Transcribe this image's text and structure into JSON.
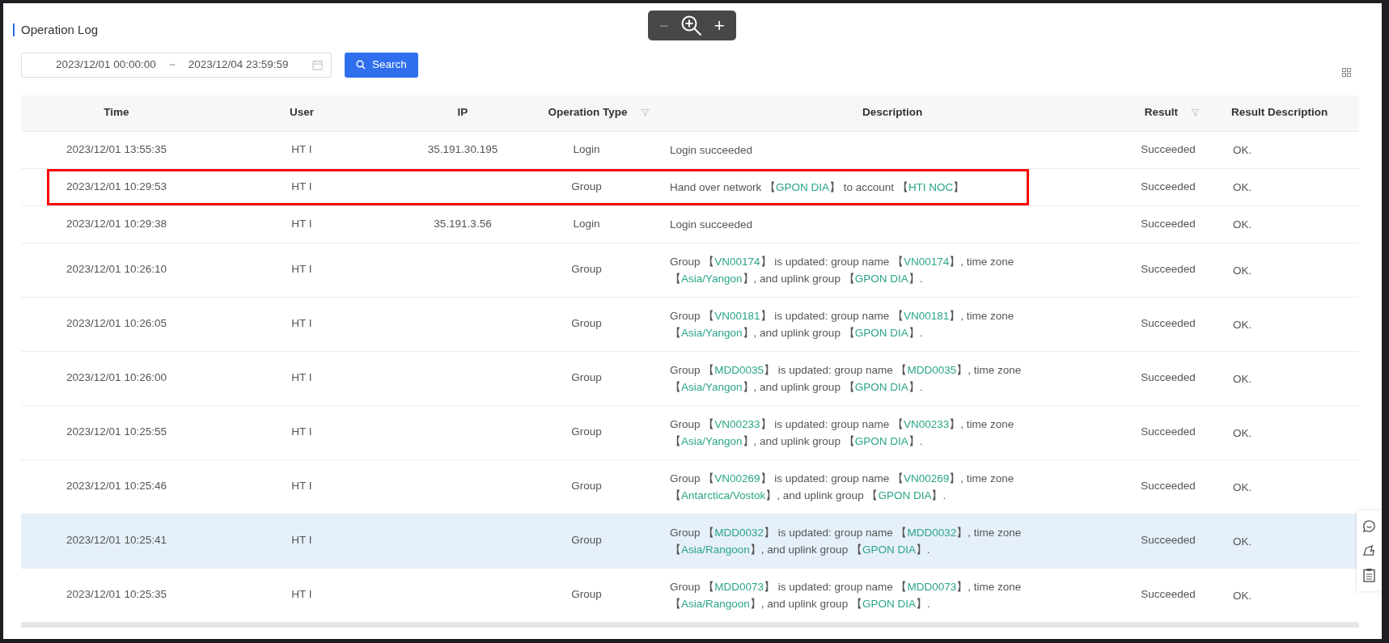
{
  "page_title": "Operation Log",
  "zoom_toolbar": {
    "minus": "−",
    "minus_disabled": true,
    "plus": "+"
  },
  "date_range": {
    "start": "2023/12/01 00:00:00",
    "separator": "~",
    "end": "2023/12/04 23:59:59"
  },
  "search_button": "Search",
  "table": {
    "columns": [
      {
        "label": "Time",
        "filter": false
      },
      {
        "label": "User",
        "filter": false
      },
      {
        "label": "IP",
        "filter": false
      },
      {
        "label": "Operation Type",
        "filter": true
      },
      {
        "label": "Description",
        "filter": false
      },
      {
        "label": "Result",
        "filter": true
      },
      {
        "label": "Result Description",
        "filter": false
      }
    ],
    "rows": [
      {
        "time": "2023/12/01 13:55:35",
        "user": "HT I",
        "ip": "35.191.30.195",
        "operation_type": "Login",
        "description": [
          {
            "text": "Login succeeded",
            "kind": "plain"
          }
        ],
        "result": "Succeeded",
        "result_description": "OK.",
        "selected": false,
        "outlined": false
      },
      {
        "time": "2023/12/01 10:29:53",
        "user": "HT I",
        "ip": "",
        "operation_type": "Group",
        "description": [
          {
            "text": "Hand over network 【",
            "kind": "plain"
          },
          {
            "text": "GPON DIA",
            "kind": "link"
          },
          {
            "text": "】 to account 【",
            "kind": "plain"
          },
          {
            "text": "HTI NOC",
            "kind": "link"
          },
          {
            "text": "】",
            "kind": "plain"
          }
        ],
        "result": "Succeeded",
        "result_description": "OK.",
        "selected": false,
        "outlined": true
      },
      {
        "time": "2023/12/01 10:29:38",
        "user": "HT I",
        "ip": "35.191.3.56",
        "operation_type": "Login",
        "description": [
          {
            "text": "Login succeeded",
            "kind": "plain"
          }
        ],
        "result": "Succeeded",
        "result_description": "OK.",
        "selected": false,
        "outlined": false
      },
      {
        "time": "2023/12/01 10:26:10",
        "user": "HT I",
        "ip": "",
        "operation_type": "Group",
        "description": [
          {
            "text": "Group 【",
            "kind": "plain"
          },
          {
            "text": "VN00174",
            "kind": "link"
          },
          {
            "text": "】 is updated: group name 【",
            "kind": "plain"
          },
          {
            "text": "VN00174",
            "kind": "link"
          },
          {
            "text": "】, time zone 【",
            "kind": "plain"
          },
          {
            "text": "Asia/Yangon",
            "kind": "link"
          },
          {
            "text": "】, and uplink group 【",
            "kind": "plain"
          },
          {
            "text": "GPON DIA",
            "kind": "link"
          },
          {
            "text": "】.",
            "kind": "plain"
          }
        ],
        "result": "Succeeded",
        "result_description": "OK.",
        "selected": false,
        "outlined": false
      },
      {
        "time": "2023/12/01 10:26:05",
        "user": "HT I",
        "ip": "",
        "operation_type": "Group",
        "description": [
          {
            "text": "Group 【",
            "kind": "plain"
          },
          {
            "text": "VN00181",
            "kind": "link"
          },
          {
            "text": "】 is updated: group name 【",
            "kind": "plain"
          },
          {
            "text": "VN00181",
            "kind": "link"
          },
          {
            "text": "】, time zone 【",
            "kind": "plain"
          },
          {
            "text": "Asia/Yangon",
            "kind": "link"
          },
          {
            "text": "】, and uplink group 【",
            "kind": "plain"
          },
          {
            "text": "GPON DIA",
            "kind": "link"
          },
          {
            "text": "】.",
            "kind": "plain"
          }
        ],
        "result": "Succeeded",
        "result_description": "OK.",
        "selected": false,
        "outlined": false
      },
      {
        "time": "2023/12/01 10:26:00",
        "user": "HT I",
        "ip": "",
        "operation_type": "Group",
        "description": [
          {
            "text": "Group 【",
            "kind": "plain"
          },
          {
            "text": "MDD0035",
            "kind": "link"
          },
          {
            "text": "】 is updated: group name 【",
            "kind": "plain"
          },
          {
            "text": "MDD0035",
            "kind": "link"
          },
          {
            "text": "】, time zone 【",
            "kind": "plain"
          },
          {
            "text": "Asia/Yangon",
            "kind": "link"
          },
          {
            "text": "】, and uplink group 【",
            "kind": "plain"
          },
          {
            "text": "GPON DIA",
            "kind": "link"
          },
          {
            "text": "】.",
            "kind": "plain"
          }
        ],
        "result": "Succeeded",
        "result_description": "OK.",
        "selected": false,
        "outlined": false
      },
      {
        "time": "2023/12/01 10:25:55",
        "user": "HT I",
        "ip": "",
        "operation_type": "Group",
        "description": [
          {
            "text": "Group 【",
            "kind": "plain"
          },
          {
            "text": "VN00233",
            "kind": "link"
          },
          {
            "text": "】 is updated: group name 【",
            "kind": "plain"
          },
          {
            "text": "VN00233",
            "kind": "link"
          },
          {
            "text": "】, time zone 【",
            "kind": "plain"
          },
          {
            "text": "Asia/Yangon",
            "kind": "link"
          },
          {
            "text": "】, and uplink group 【",
            "kind": "plain"
          },
          {
            "text": "GPON DIA",
            "kind": "link"
          },
          {
            "text": "】.",
            "kind": "plain"
          }
        ],
        "result": "Succeeded",
        "result_description": "OK.",
        "selected": false,
        "outlined": false
      },
      {
        "time": "2023/12/01 10:25:46",
        "user": "HT I",
        "ip": "",
        "operation_type": "Group",
        "description": [
          {
            "text": "Group 【",
            "kind": "plain"
          },
          {
            "text": "VN00269",
            "kind": "link"
          },
          {
            "text": "】 is updated: group name 【",
            "kind": "plain"
          },
          {
            "text": "VN00269",
            "kind": "link"
          },
          {
            "text": "】, time zone 【",
            "kind": "plain"
          },
          {
            "text": "Antarctica/Vostok",
            "kind": "link"
          },
          {
            "text": "】, and uplink group 【",
            "kind": "plain"
          },
          {
            "text": "GPON DIA",
            "kind": "link"
          },
          {
            "text": "】.",
            "kind": "plain"
          }
        ],
        "result": "Succeeded",
        "result_description": "OK.",
        "selected": false,
        "outlined": false
      },
      {
        "time": "2023/12/01 10:25:41",
        "user": "HT I",
        "ip": "",
        "operation_type": "Group",
        "description": [
          {
            "text": "Group 【",
            "kind": "plain"
          },
          {
            "text": "MDD0032",
            "kind": "link"
          },
          {
            "text": "】 is updated: group name 【",
            "kind": "plain"
          },
          {
            "text": "MDD0032",
            "kind": "link"
          },
          {
            "text": "】, time zone 【",
            "kind": "plain"
          },
          {
            "text": "Asia/Rangoon",
            "kind": "link"
          },
          {
            "text": "】, and uplink group 【",
            "kind": "plain"
          },
          {
            "text": "GPON DIA",
            "kind": "link"
          },
          {
            "text": "】.",
            "kind": "plain"
          }
        ],
        "result": "Succeeded",
        "result_description": "OK.",
        "selected": true,
        "outlined": false
      },
      {
        "time": "2023/12/01 10:25:35",
        "user": "HT I",
        "ip": "",
        "operation_type": "Group",
        "description": [
          {
            "text": "Group 【",
            "kind": "plain"
          },
          {
            "text": "MDD0073",
            "kind": "link"
          },
          {
            "text": "】 is updated: group name 【",
            "kind": "plain"
          },
          {
            "text": "MDD0073",
            "kind": "link"
          },
          {
            "text": "】, time zone 【",
            "kind": "plain"
          },
          {
            "text": "Asia/Rangoon",
            "kind": "link"
          },
          {
            "text": "】, and uplink group 【",
            "kind": "plain"
          },
          {
            "text": "GPON DIA",
            "kind": "link"
          },
          {
            "text": "】.",
            "kind": "plain"
          }
        ],
        "result": "Succeeded",
        "result_description": "OK.",
        "selected": false,
        "outlined": false
      }
    ]
  }
}
